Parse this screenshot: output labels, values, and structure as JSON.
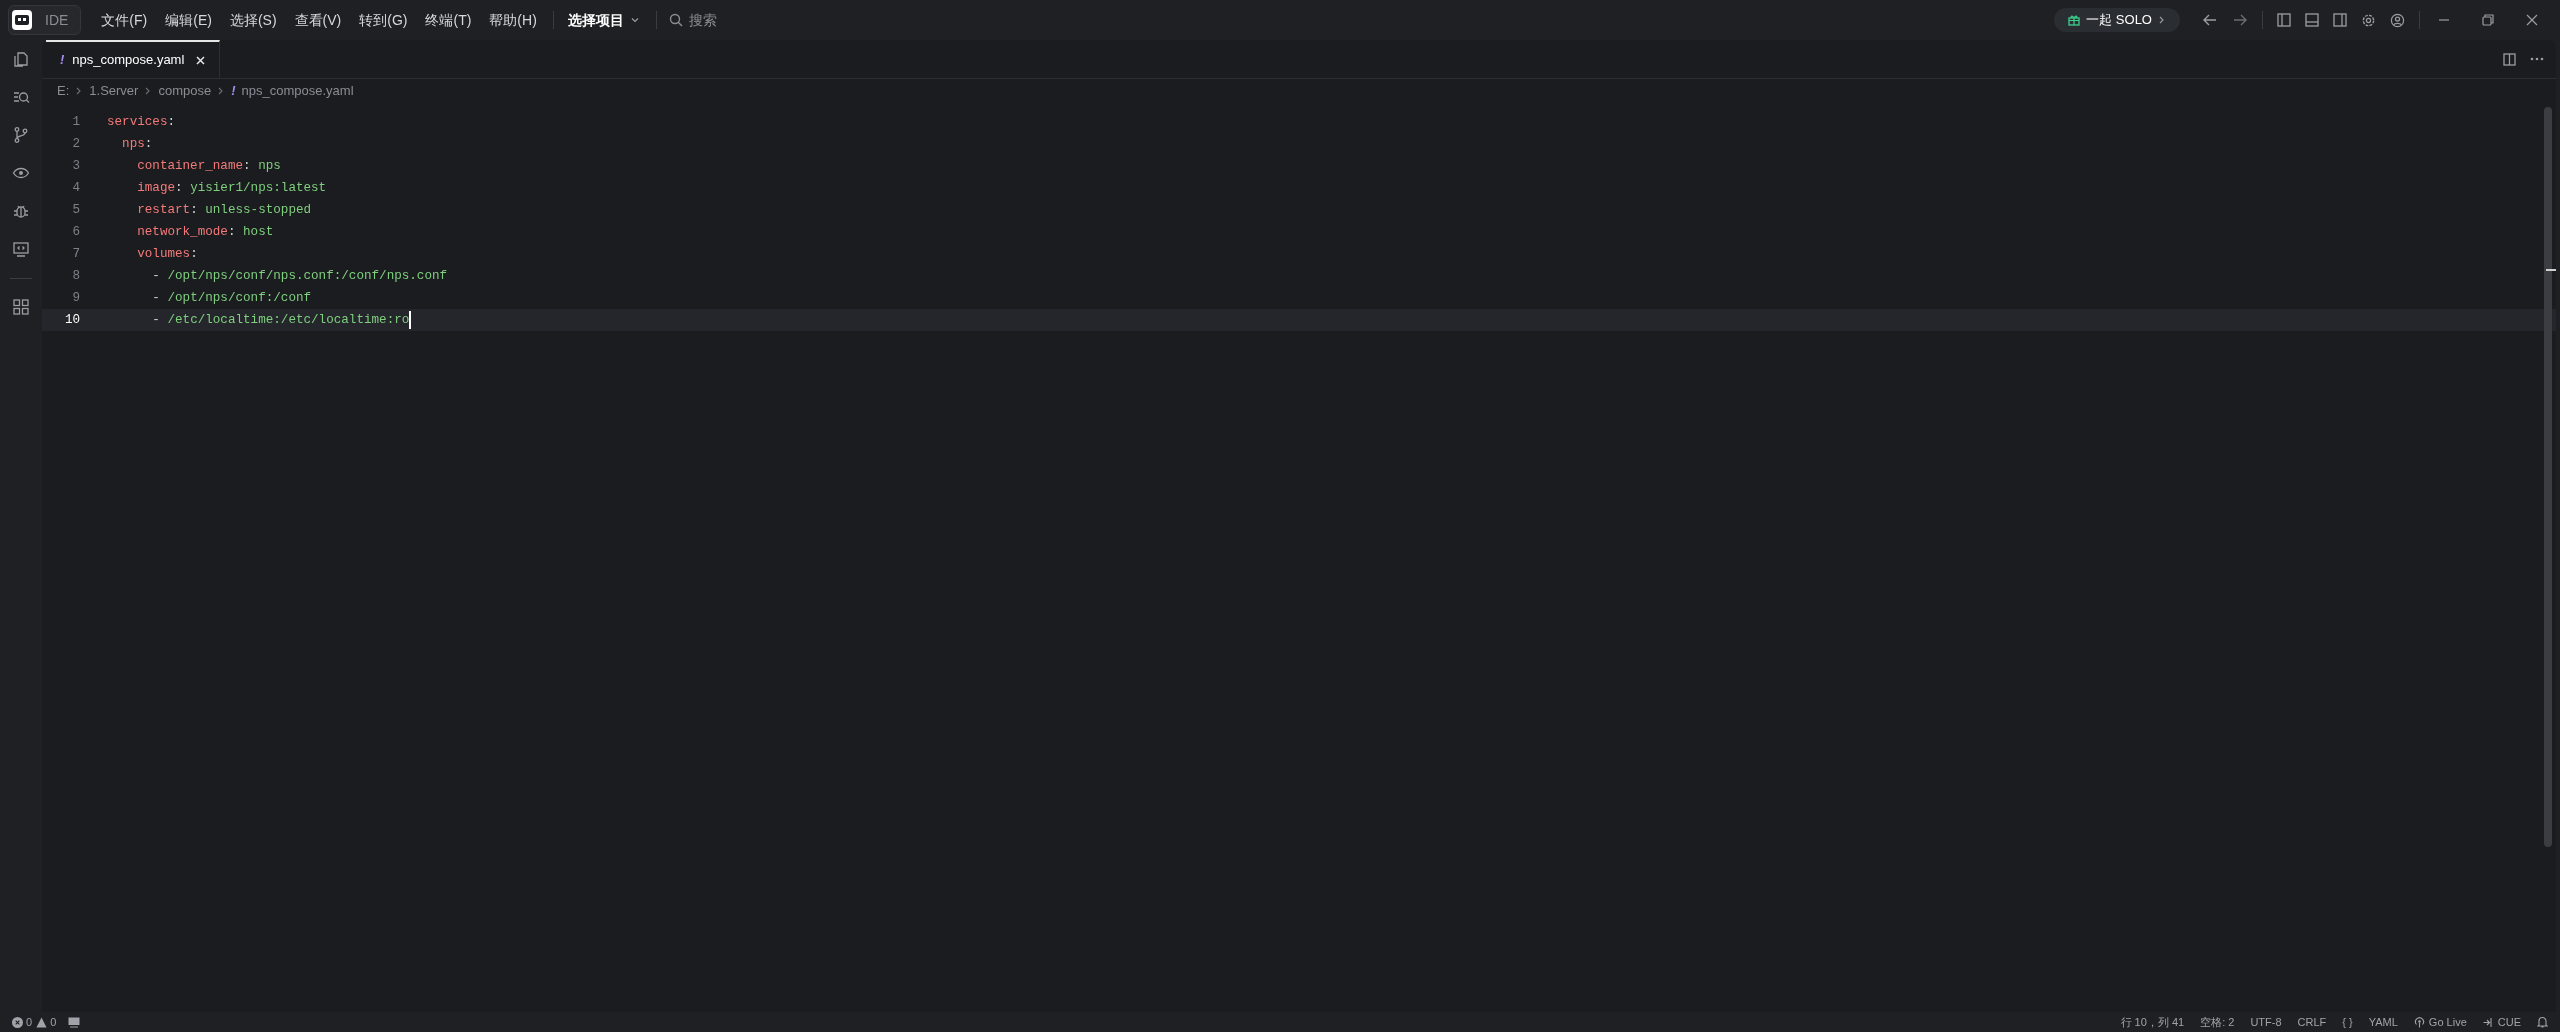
{
  "app": {
    "badge": "IDE"
  },
  "menu": [
    "文件(F)",
    "编辑(E)",
    "选择(S)",
    "查看(V)",
    "转到(G)",
    "终端(T)",
    "帮助(H)"
  ],
  "project_picker": "选择项目",
  "search": {
    "placeholder": "搜索"
  },
  "solo_button": "一起 SOLO",
  "tabs": [
    {
      "icon": "!",
      "label": "nps_compose.yaml",
      "selected": true
    }
  ],
  "breadcrumb": [
    "E:",
    "1.Server",
    "compose",
    "nps_compose.yaml"
  ],
  "breadcrumb_file_icon": "!",
  "lines": [
    {
      "number": "1",
      "selected": false,
      "tokens": [
        {
          "kind": "key",
          "text": "services"
        },
        {
          "kind": "punct",
          "text": ":"
        }
      ],
      "children": [
        {
          "number": "2",
          "selected": false,
          "tokens": [
            {
              "kind": "key",
              "text": "nps"
            },
            {
              "kind": "punct",
              "text": ":"
            }
          ],
          "children": [
            {
              "number": "3",
              "selected": false,
              "tokens": [
                {
                  "kind": "key",
                  "text": "container_name"
                },
                {
                  "kind": "punct",
                  "text": ": "
                },
                {
                  "kind": "value",
                  "text": "nps"
                }
              ]
            },
            {
              "number": "4",
              "selected": false,
              "tokens": [
                {
                  "kind": "key",
                  "text": "image"
                },
                {
                  "kind": "punct",
                  "text": ": "
                },
                {
                  "kind": "value",
                  "text": "yisier1/nps:latest"
                }
              ]
            },
            {
              "number": "5",
              "selected": false,
              "tokens": [
                {
                  "kind": "key",
                  "text": "restart"
                },
                {
                  "kind": "punct",
                  "text": ": "
                },
                {
                  "kind": "value",
                  "text": "unless-stopped"
                }
              ]
            },
            {
              "number": "6",
              "selected": false,
              "tokens": [
                {
                  "kind": "key",
                  "text": "network_mode"
                },
                {
                  "kind": "punct",
                  "text": ": "
                },
                {
                  "kind": "value",
                  "text": "host"
                }
              ]
            },
            {
              "number": "7",
              "selected": false,
              "tokens": [
                {
                  "kind": "key",
                  "text": "volumes"
                },
                {
                  "kind": "punct",
                  "text": ":"
                }
              ],
              "children": [
                {
                  "number": "8",
                  "selected": false,
                  "tokens": [
                    {
                      "kind": "punct",
                      "text": "- "
                    },
                    {
                      "kind": "value",
                      "text": "/opt/nps/conf/nps.conf:/conf/nps.conf"
                    }
                  ]
                },
                {
                  "number": "9",
                  "selected": false,
                  "tokens": [
                    {
                      "kind": "punct",
                      "text": "- "
                    },
                    {
                      "kind": "value",
                      "text": "/opt/nps/conf:/conf"
                    }
                  ]
                },
                {
                  "number": "10",
                  "selected": true,
                  "tokens": [
                    {
                      "kind": "punct",
                      "text": "- "
                    },
                    {
                      "kind": "value",
                      "text": "/etc/localtime:/etc/localtime:ro"
                    }
                  ]
                }
              ]
            }
          ]
        }
      ]
    }
  ],
  "status_bar": {
    "errors": "0",
    "warnings": "0",
    "right": [
      "行 10，列 41",
      "空格: 2",
      "UTF-8",
      "CRLF",
      "{ }",
      "YAML",
      "Go Live",
      "CUE"
    ]
  }
}
